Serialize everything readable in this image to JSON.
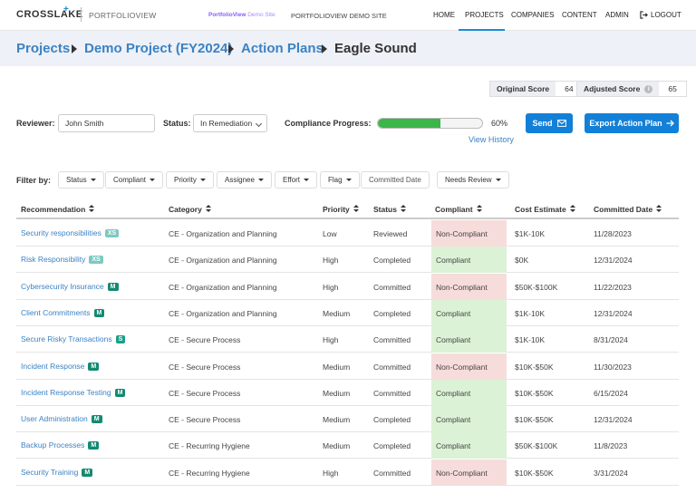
{
  "nav": {
    "brand": "CROSSLAKE",
    "brand_plus": "+",
    "product": "PORTFOLIOVIEW",
    "demo_badge_a": "PortfolioView",
    "demo_badge_b": "Demo Site",
    "site_name": "PORTFOLIOVIEW DEMO SITE",
    "items": [
      {
        "label": "HOME"
      },
      {
        "label": "PROJECTS"
      },
      {
        "label": "COMPANIES"
      },
      {
        "label": "CONTENT"
      },
      {
        "label": "ADMIN"
      },
      {
        "label": "LOGOUT"
      }
    ],
    "active": "PROJECTS"
  },
  "breadcrumb": [
    "Projects",
    "Demo Project (FY2024)",
    "Action Plans",
    "Eagle Sound"
  ],
  "scores": {
    "original_label": "Original Score",
    "original_value": "64",
    "adjusted_label": "Adjusted Score",
    "adjusted_value": "65",
    "info_glyph": "i"
  },
  "review": {
    "reviewer_label": "Reviewer:",
    "reviewer_value": "John Smith",
    "status_label": "Status:",
    "status_value": "In Remediation",
    "progress_label": "Compliance Progress:",
    "progress_value": 0.6,
    "progress_text": "60%",
    "view_history": "View History",
    "send_label": "Send",
    "export_label": "Export Action Plan"
  },
  "filters": {
    "label": "Filter by:",
    "items": [
      "Status",
      "Compliant",
      "Priority",
      "Assignee",
      "Effort",
      "Flag",
      "Committed Date",
      "Needs Review"
    ]
  },
  "table": {
    "columns": [
      "Recommendation",
      "Category",
      "Priority",
      "Status",
      "Compliant",
      "Cost Estimate",
      "Committed Date"
    ],
    "rows": [
      {
        "rec": "Security responsibilities",
        "badge": "XS",
        "category": "CE - Organization and Planning",
        "priority": "Low",
        "status": "Reviewed",
        "compliant": "Non-Compliant",
        "cost": "$1K-10K",
        "date": "11/28/2023"
      },
      {
        "rec": "Risk Responsibility",
        "badge": "XS",
        "category": "CE - Organization and Planning",
        "priority": "High",
        "status": "Completed",
        "compliant": "Compliant",
        "cost": "$0K",
        "date": "12/31/2024"
      },
      {
        "rec": "Cybersecurity Insurance",
        "badge": "M",
        "category": "CE - Organization and Planning",
        "priority": "High",
        "status": "Committed",
        "compliant": "Non-Compliant",
        "cost": "$50K-$100K",
        "date": "11/22/2023"
      },
      {
        "rec": "Client Commitments",
        "badge": "M",
        "category": "CE - Organization and Planning",
        "priority": "Medium",
        "status": "Completed",
        "compliant": "Compliant",
        "cost": "$1K-10K",
        "date": "12/31/2024"
      },
      {
        "rec": "Secure Risky Transactions",
        "badge": "S",
        "category": "CE - Secure Process",
        "priority": "High",
        "status": "Committed",
        "compliant": "Compliant",
        "cost": "$1K-10K",
        "date": "8/31/2024"
      },
      {
        "rec": "Incident Response",
        "badge": "M",
        "category": "CE - Secure Process",
        "priority": "Medium",
        "status": "Committed",
        "compliant": "Non-Compliant",
        "cost": "$10K-$50K",
        "date": "11/30/2023"
      },
      {
        "rec": "Incident Response Testing",
        "badge": "M",
        "category": "CE - Secure Process",
        "priority": "Medium",
        "status": "Committed",
        "compliant": "Compliant",
        "cost": "$10K-$50K",
        "date": "6/15/2024"
      },
      {
        "rec": "User Administration",
        "badge": "M",
        "category": "CE - Secure Process",
        "priority": "Medium",
        "status": "Completed",
        "compliant": "Compliant",
        "cost": "$10K-$50K",
        "date": "12/31/2024"
      },
      {
        "rec": "Backup Processes",
        "badge": "M",
        "category": "CE - Recurring Hygiene",
        "priority": "Medium",
        "status": "Completed",
        "compliant": "Compliant",
        "cost": "$50K-$100K",
        "date": "11/8/2023"
      },
      {
        "rec": "Security Training",
        "badge": "M",
        "category": "CE - Recurring Hygiene",
        "priority": "High",
        "status": "Committed",
        "compliant": "Non-Compliant",
        "cost": "$10K-$50K",
        "date": "3/31/2024"
      }
    ]
  },
  "colors": {
    "accent": "#1380d8",
    "link": "#3b82c4",
    "compliant_bg": "#dcf2d6",
    "noncompliant_bg": "#f7dcdc",
    "badge_xs": "#7ec9c0",
    "badge_m": "#138a72",
    "badge_s": "#1aa08a",
    "progress_fill": "#3cb54a"
  },
  "icons": {
    "logout": "logout-icon",
    "send": "envelope-icon",
    "export": "arrow-right-icon"
  }
}
